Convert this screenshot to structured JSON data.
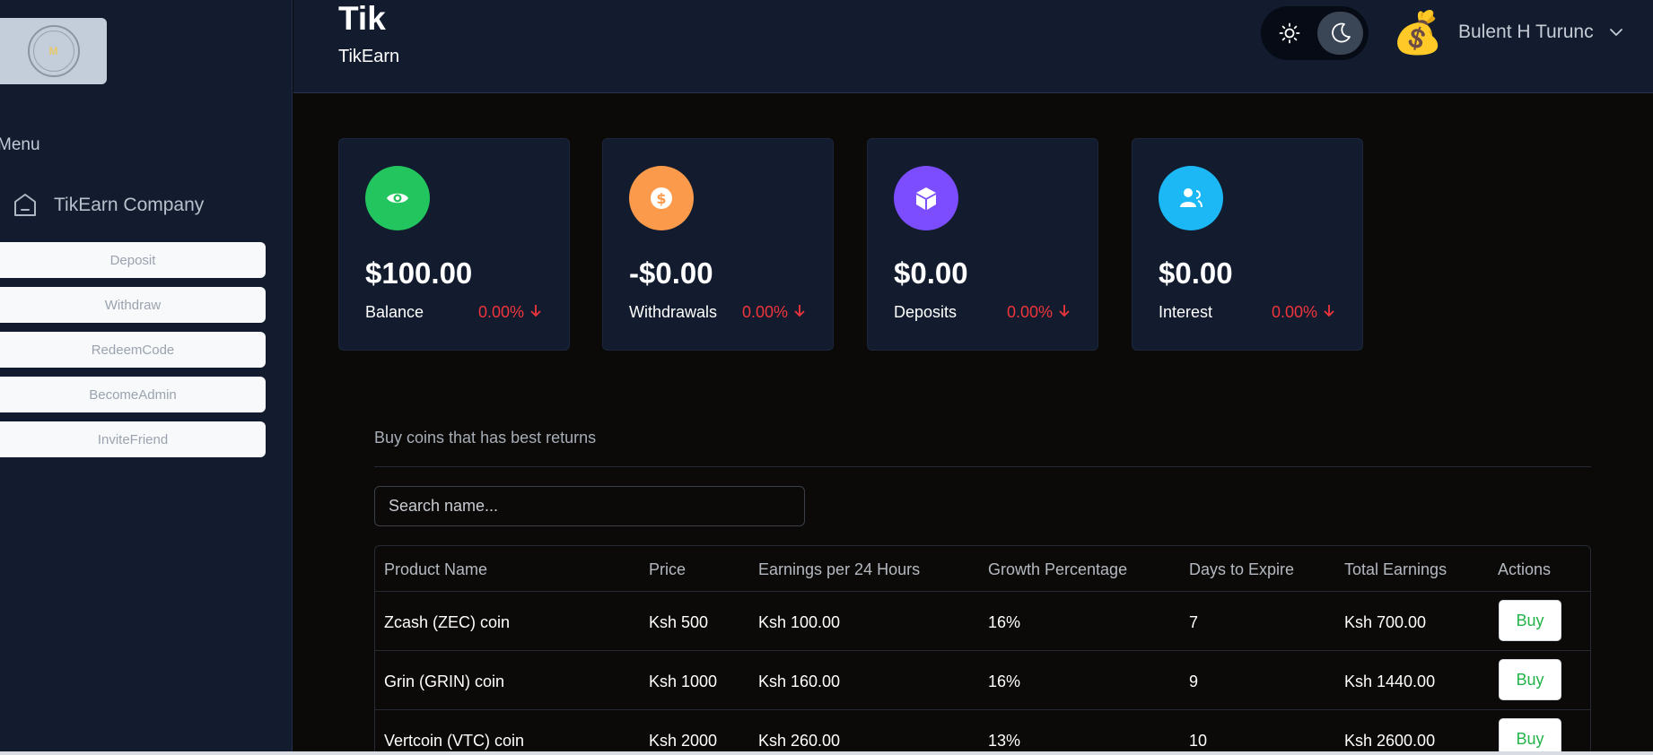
{
  "sidebar": {
    "logo_letter": "M",
    "menu_label": "Menu",
    "company_label": "TikEarn Company",
    "buttons": [
      "Deposit",
      "Withdraw",
      "RedeemCode",
      "BecomeAdmin",
      "InviteFriend"
    ]
  },
  "header": {
    "title": "Tik",
    "subtitle": "TikEarn",
    "user_name": "Bulent H Turunc",
    "theme_icons": [
      "sun-icon",
      "moon-icon"
    ],
    "avatar_icon": "money-bag-icon"
  },
  "stats": [
    {
      "value": "$100.00",
      "label": "Balance",
      "change": "0.00%",
      "icon": "eye-icon",
      "color": "#22c55e"
    },
    {
      "value": "-$0.00",
      "label": "Withdrawals",
      "change": "0.00%",
      "icon": "dollar-coin-icon",
      "color": "#fb9a4b"
    },
    {
      "value": "$0.00",
      "label": "Deposits",
      "change": "0.00%",
      "icon": "box-icon",
      "color": "#7c4dff"
    },
    {
      "value": "$0.00",
      "label": "Interest",
      "change": "0.00%",
      "icon": "users-icon",
      "color": "#1bb8f5"
    }
  ],
  "products": {
    "title": "Buy coins that has best returns",
    "search_placeholder": "Search name...",
    "columns": [
      "Product Name",
      "Price",
      "Earnings per 24 Hours",
      "Growth Percentage",
      "Days to Expire",
      "Total Earnings",
      "Actions"
    ],
    "rows": [
      {
        "name": "Zcash (ZEC) coin",
        "price": "Ksh 500",
        "earnings": "Ksh 100.00",
        "growth": "16%",
        "days": "7",
        "total": "Ksh 700.00",
        "action": "Buy"
      },
      {
        "name": "Grin (GRIN) coin",
        "price": "Ksh 1000",
        "earnings": "Ksh 160.00",
        "growth": "16%",
        "days": "9",
        "total": "Ksh 1440.00",
        "action": "Buy"
      },
      {
        "name": "Vertcoin (VTC) coin",
        "price": "Ksh 2000",
        "earnings": "Ksh 260.00",
        "growth": "13%",
        "days": "10",
        "total": "Ksh 2600.00",
        "action": "Buy"
      }
    ]
  },
  "colors": {
    "panel": "#121c2e",
    "background": "#0b0a08",
    "negative": "#f0343c",
    "buy_text": "#22b34a"
  }
}
